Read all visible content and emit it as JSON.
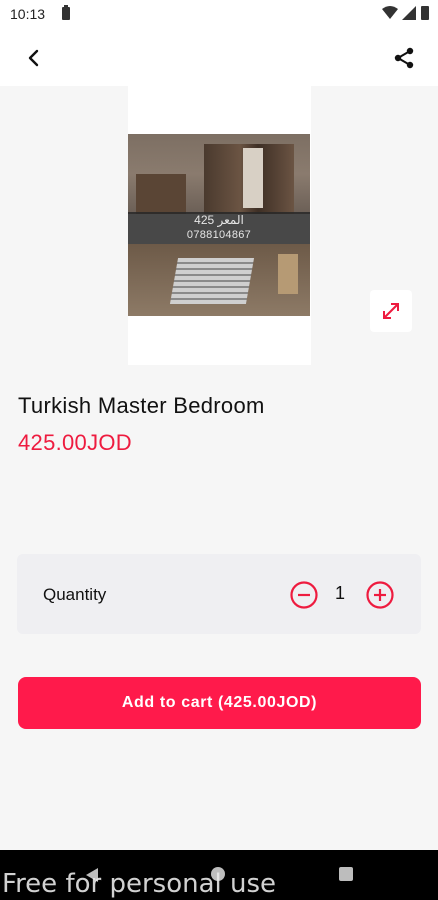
{
  "status_bar": {
    "time": "10:13"
  },
  "product": {
    "image_overlay_line1": "المعر 425",
    "image_overlay_line2": "0788104867",
    "title": "Turkish Master Bedroom",
    "price": "425.00JOD"
  },
  "quantity": {
    "label": "Quantity",
    "value": "1"
  },
  "cart": {
    "button_label": "Add to cart (425.00JOD)"
  },
  "footer": {
    "watermark": "Free for personal use"
  },
  "icons": {
    "back": "arrow-back-icon",
    "share": "share-icon",
    "expand": "expand-icon",
    "minus": "minus-circle-icon",
    "plus": "plus-circle-icon"
  },
  "colors": {
    "accent": "#ff1a4b",
    "price": "#ee1b3f"
  }
}
